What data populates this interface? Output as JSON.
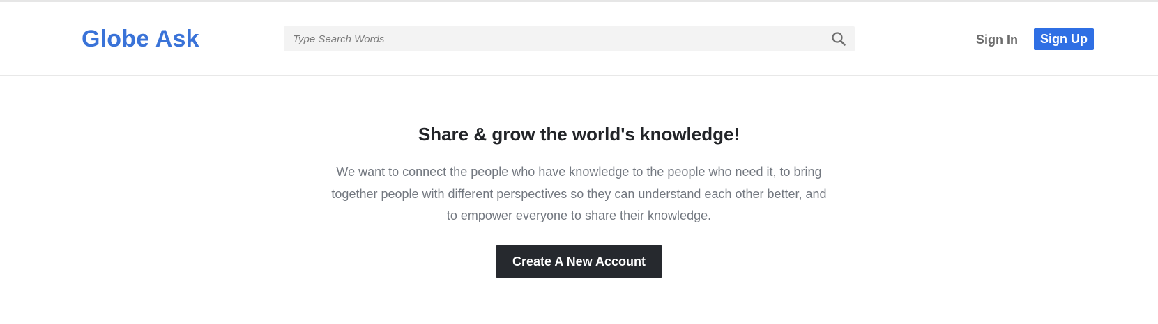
{
  "header": {
    "logo_text": "Globe Ask",
    "search": {
      "placeholder": "Type Search Words",
      "value": "",
      "icon": "search-icon"
    },
    "sign_in_label": "Sign In",
    "sign_up_label": "Sign Up"
  },
  "hero": {
    "title": "Share & grow the world's knowledge!",
    "description": "We want to connect the people who have knowledge to the people who need it, to bring together people with different perspectives so they can understand each other better, and to empower everyone to share their knowledge.",
    "cta_label": "Create A New Account"
  },
  "colors": {
    "brand": "#3a73d8",
    "primary_button": "#2f6fe4",
    "dark_button": "#26292e",
    "title_text": "#222428",
    "body_text": "#737880"
  }
}
